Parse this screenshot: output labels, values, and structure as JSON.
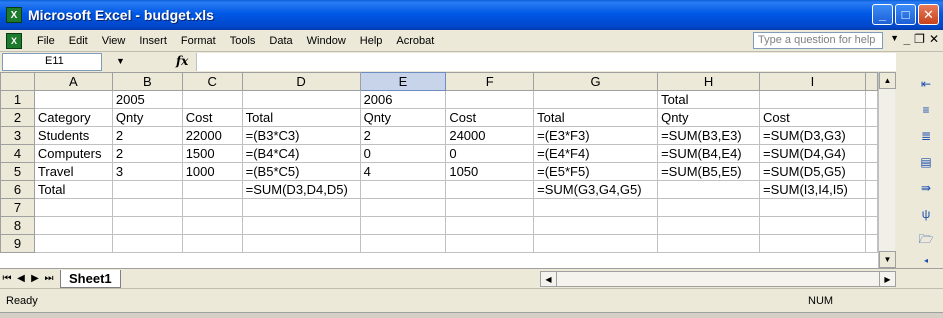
{
  "window": {
    "title": "Microsoft Excel - budget.xls",
    "app_icon": "excel-icon"
  },
  "menu": {
    "items": [
      "File",
      "Edit",
      "View",
      "Insert",
      "Format",
      "Tools",
      "Data",
      "Window",
      "Help",
      "Acrobat"
    ],
    "help_placeholder": "Type a question for help"
  },
  "formula_bar": {
    "name_box": "E11",
    "fx_label": "fx",
    "formula": ""
  },
  "columns": [
    "A",
    "B",
    "C",
    "D",
    "E",
    "F",
    "G",
    "H",
    "I"
  ],
  "selected_column": "E",
  "rows": [
    {
      "num": "1",
      "cells": [
        "",
        "2005",
        "",
        "",
        "2006",
        "",
        "",
        "Total",
        ""
      ]
    },
    {
      "num": "2",
      "cells": [
        "Category",
        "Qnty",
        "Cost",
        "Total",
        "Qnty",
        "Cost",
        "Total",
        "Qnty",
        "Cost"
      ]
    },
    {
      "num": "3",
      "cells": [
        "Students",
        "2",
        "22000",
        "=(B3*C3)",
        "2",
        "24000",
        "=(E3*F3)",
        "=SUM(B3,E3)",
        "=SUM(D3,G3)"
      ]
    },
    {
      "num": "4",
      "cells": [
        "Computers",
        "2",
        "1500",
        "=(B4*C4)",
        "0",
        "0",
        "=(E4*F4)",
        "=SUM(B4,E4)",
        "=SUM(D4,G4)"
      ]
    },
    {
      "num": "5",
      "cells": [
        "Travel",
        "3",
        "1000",
        "=(B5*C5)",
        "4",
        "1050",
        "=(E5*F5)",
        "=SUM(B5,E5)",
        "=SUM(D5,G5)"
      ]
    },
    {
      "num": "6",
      "cells": [
        "Total",
        "",
        "",
        "=SUM(D3,D4,D5)",
        "",
        "",
        "=SUM(G3,G4,G5)",
        "",
        "=SUM(I3,I4,I5)"
      ]
    },
    {
      "num": "7",
      "cells": [
        "",
        "",
        "",
        "",
        "",
        "",
        "",
        "",
        ""
      ]
    },
    {
      "num": "8",
      "cells": [
        "",
        "",
        "",
        "",
        "",
        "",
        "",
        "",
        ""
      ]
    },
    {
      "num": "9",
      "cells": [
        "",
        "",
        "",
        "",
        "",
        "",
        "",
        "",
        ""
      ]
    }
  ],
  "sheet_tabs": [
    "Sheet1"
  ],
  "status": {
    "left": "Ready",
    "num_indicator": "NUM"
  },
  "colors": {
    "titlebar": "#0058e6",
    "selected_header": "#c8d4ea",
    "chrome": "#ece9d8"
  }
}
